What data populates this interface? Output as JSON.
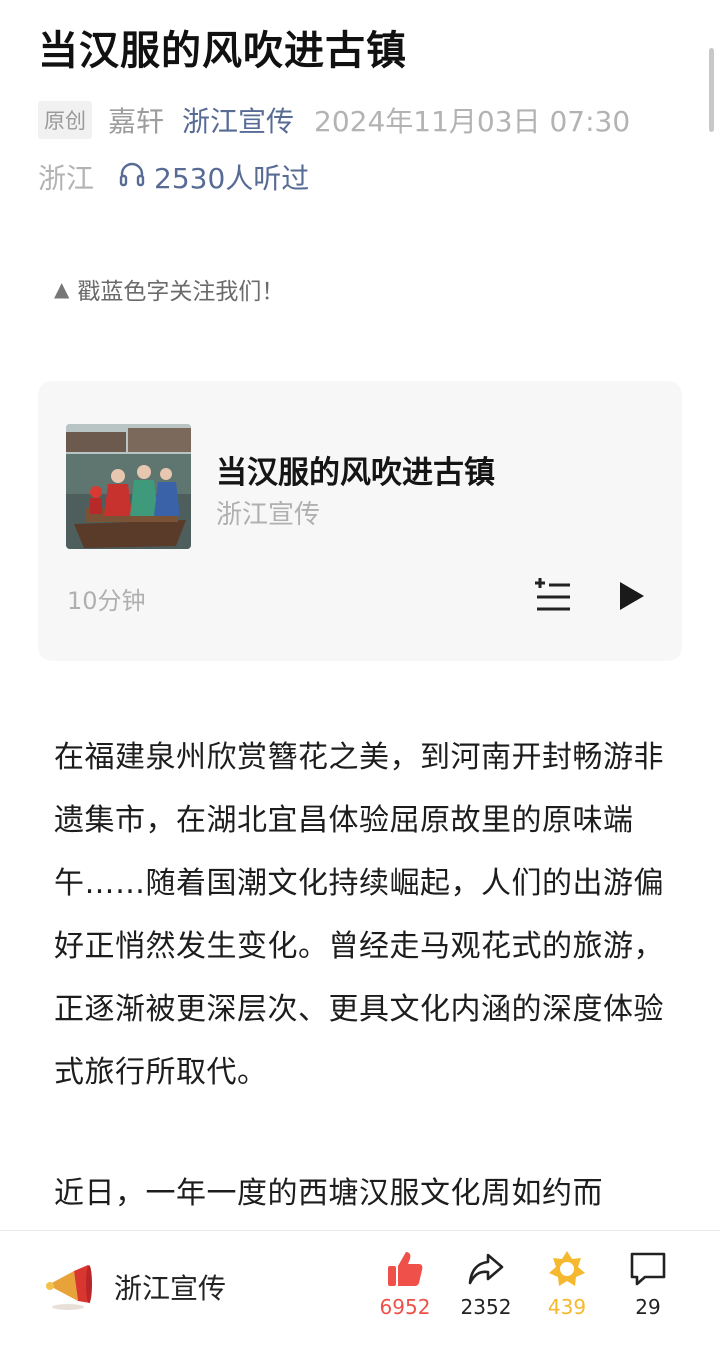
{
  "article": {
    "title": "当汉服的风吹进古镇",
    "badge": "原创",
    "author": "嘉轩",
    "account": "浙江宣传",
    "datetime": "2024年11月03日 07:30",
    "region": "浙江",
    "listen_count": "2530人听过",
    "follow_prompt": "戳蓝色字关注我们！",
    "paragraph1": "在福建泉州欣赏簪花之美，到河南开封畅游非遗集市，在湖北宜昌体验屈原故里的原味端午……随着国潮文化持续崛起，人们的出游偏好正悄然发生变化。曾经走马观花式的旅游，正逐渐被更深层次、更具文化内涵的深度体验式旅行所取代。",
    "paragraph2": "近日，一年一度的西塘汉服文化周如约而"
  },
  "audio": {
    "title": "当汉服的风吹进古镇",
    "author": "浙江宣传",
    "duration": "10分钟"
  },
  "bottom_bar": {
    "account_name": "浙江宣传",
    "like_count": "6952",
    "share_count": "2352",
    "wow_count": "439",
    "comment_count": "29"
  },
  "colors": {
    "link_blue": "#576b95",
    "like_red": "#f0504a",
    "wow_gold": "#f5b82e",
    "muted_gray": "#b3b3b3"
  },
  "icons": {
    "listen": "headphones-icon",
    "playlist": "playlist-add-icon",
    "play": "play-icon",
    "like": "thumbs-up-icon",
    "share": "share-arrow-icon",
    "wow": "wow-star-icon",
    "comment": "comment-bubble-icon"
  }
}
